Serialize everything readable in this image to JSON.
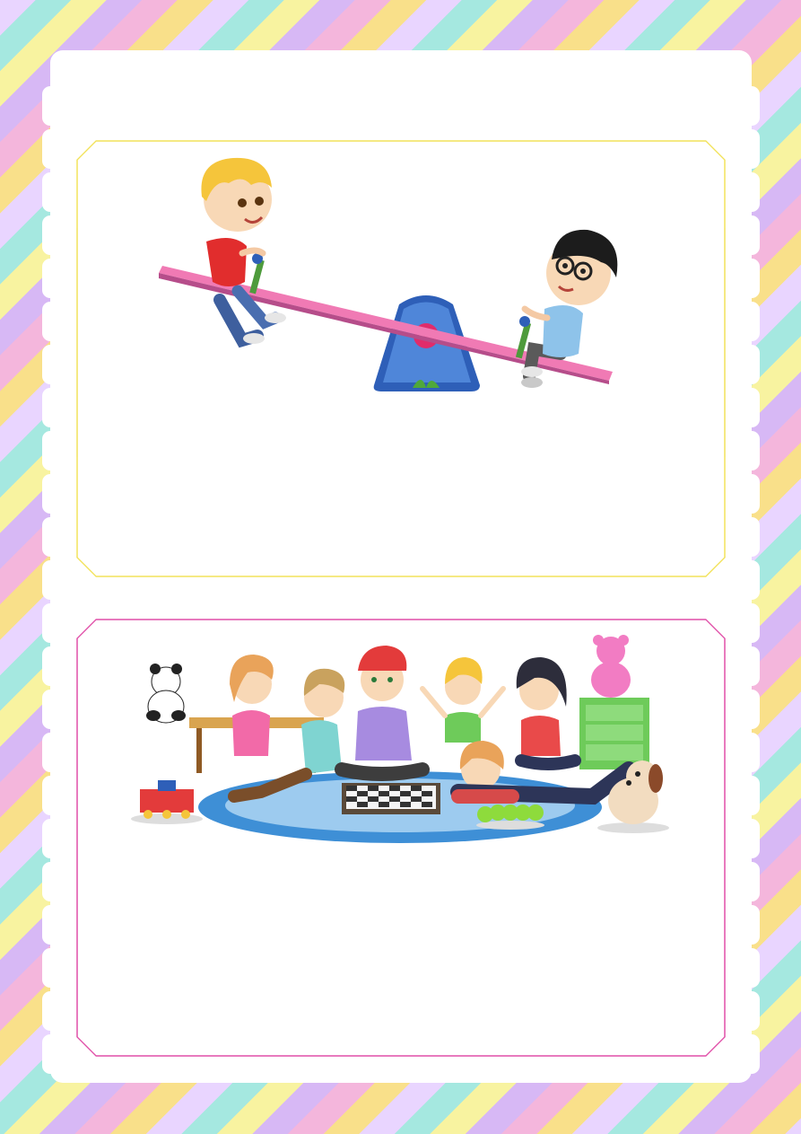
{
  "page": {
    "colors": {
      "background_stripes": [
        "#e9d5ff",
        "#a5e8e0",
        "#f8f3a0",
        "#d7b8f5",
        "#f4b6dc",
        "#f9e08a"
      ],
      "sheet": "#ffffff",
      "top_card_border": "#f2e25a",
      "bottom_card_border": "#e04fa8"
    }
  },
  "cards": [
    {
      "id": "seesaw",
      "illustration": "two-boys-on-seesaw-illustration",
      "caption": ""
    },
    {
      "id": "board-game",
      "illustration": "kids-playing-chess-illustration",
      "caption": ""
    }
  ]
}
